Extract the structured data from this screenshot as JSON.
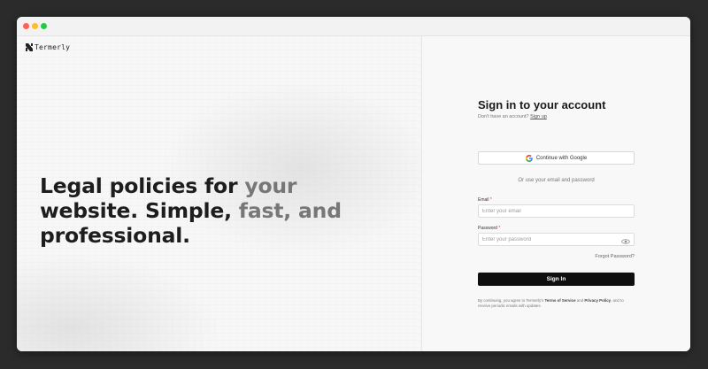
{
  "brand": {
    "name": "Termerly"
  },
  "hero": {
    "line1a": "Legal policies for ",
    "line1b": "your",
    "line2a": "website. Simple, ",
    "line2b": "fast, and",
    "line3": "professional."
  },
  "signin": {
    "title": "Sign in to your account",
    "no_account": "Don't have an account?",
    "signup_link": "Sign up",
    "google_label": "Continue with Google",
    "divider": "Or use your email and password",
    "email_label": "Email",
    "email_placeholder": "Enter your email",
    "password_label": "Password",
    "password_placeholder": "Enter your password",
    "required_mark": "*",
    "forgot": "Forgot Password?",
    "submit": "Sign In",
    "terms_pre": "By continuing, you agree to Termerly's",
    "terms_link": "Terms of Service",
    "terms_and": "and",
    "privacy_link": "Privacy Policy",
    "terms_post": ", and to receive periodic emails with updates."
  },
  "colors": {
    "background": "#2b2b2b",
    "primary_button": "#0f0f0f",
    "hero_text": "#1d1d1d",
    "hero_fade": "#777777"
  }
}
